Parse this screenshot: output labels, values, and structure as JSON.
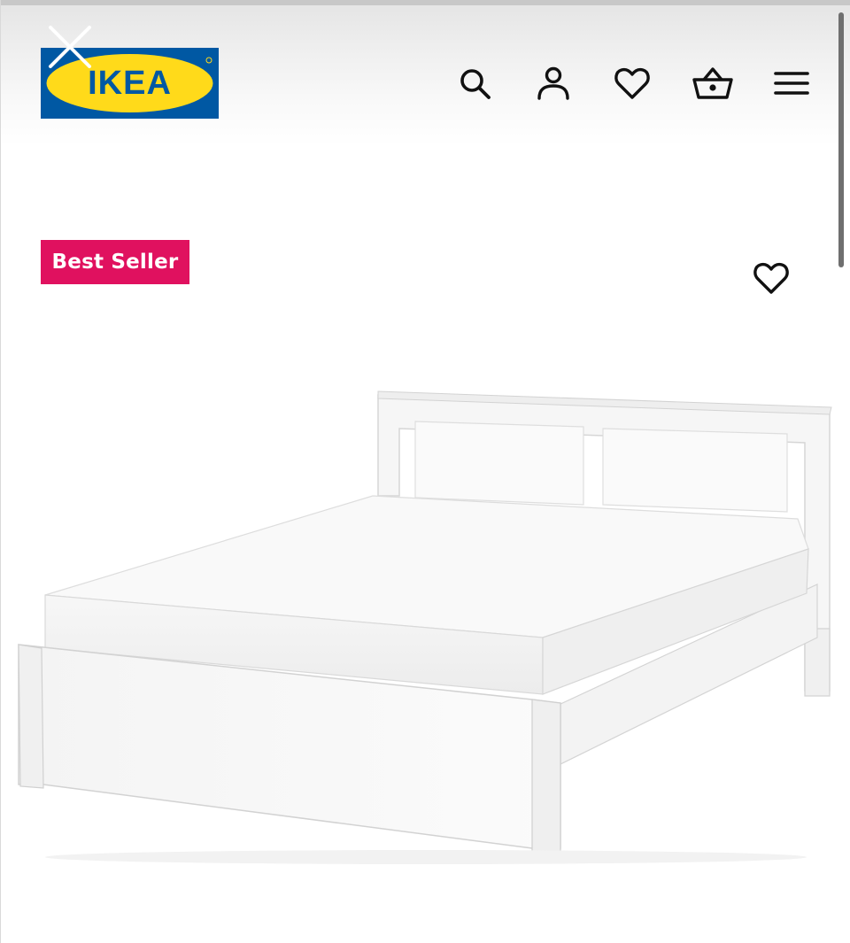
{
  "header": {
    "logo_text": "IKEA",
    "brand_colors": {
      "blue": "#0058a3",
      "yellow": "#ffda1a"
    },
    "close_icon": "close-icon",
    "nav_icons": [
      "search-icon",
      "account-icon",
      "wishlist-heart-icon",
      "shopping-basket-icon",
      "menu-icon"
    ]
  },
  "product": {
    "badge_label": "Best Seller",
    "badge_color": "#e0115f",
    "favorite_icon": "heart-outline-icon",
    "image_alt": "White bed frame with mattress"
  }
}
